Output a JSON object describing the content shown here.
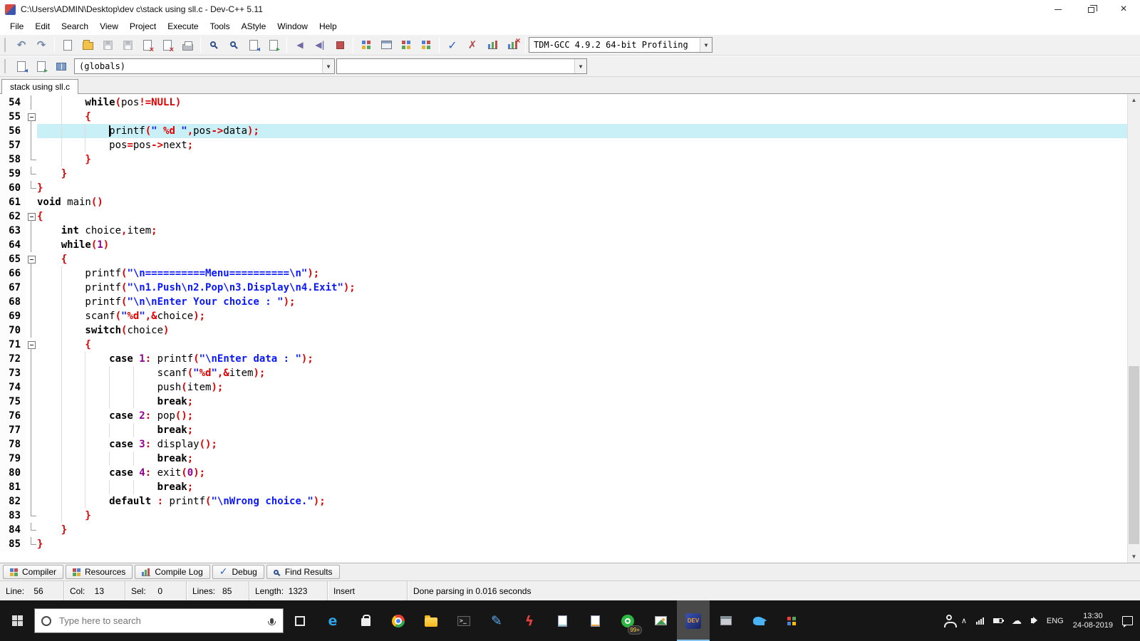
{
  "window": {
    "title": "C:\\Users\\ADMIN\\Desktop\\dev c\\stack using sll.c - Dev-C++ 5.11"
  },
  "menu": {
    "items": [
      "File",
      "Edit",
      "Search",
      "View",
      "Project",
      "Execute",
      "Tools",
      "AStyle",
      "Window",
      "Help"
    ]
  },
  "toolbar": {
    "compiler_profile": "TDM-GCC 4.9.2 64-bit Profiling",
    "globals_value": "(globals)",
    "second_value": ""
  },
  "tabs": [
    {
      "label": "stack using sll.c"
    }
  ],
  "editor": {
    "lines": [
      {
        "n": 54,
        "fold": "vline",
        "indent": 8,
        "tokens": [
          [
            "kw",
            "while"
          ],
          [
            "sym",
            "("
          ],
          [
            "pl",
            "pos"
          ],
          [
            "sym",
            "!="
          ],
          [
            "sym",
            "NULL"
          ],
          [
            "sym",
            ")"
          ]
        ]
      },
      {
        "n": 55,
        "fold": "box",
        "indent": 8,
        "tokens": [
          [
            "sym",
            "{"
          ]
        ]
      },
      {
        "n": 56,
        "fold": "vline",
        "indent": 12,
        "current": true,
        "caret_col": 13,
        "tokens": [
          [
            "pl",
            "printf"
          ],
          [
            "sym",
            "("
          ],
          [
            "str",
            "\" "
          ],
          [
            "fmt",
            "%d"
          ],
          [
            "str",
            " \""
          ],
          [
            "sym",
            ","
          ],
          [
            "pl",
            "pos"
          ],
          [
            "sym",
            "->"
          ],
          [
            "pl",
            "data"
          ],
          [
            "sym",
            ");"
          ]
        ]
      },
      {
        "n": 57,
        "fold": "vline",
        "indent": 12,
        "tokens": [
          [
            "pl",
            "pos"
          ],
          [
            "sym",
            "="
          ],
          [
            "pl",
            "pos"
          ],
          [
            "sym",
            "->"
          ],
          [
            "pl",
            "next"
          ],
          [
            "sym",
            ";"
          ]
        ]
      },
      {
        "n": 58,
        "fold": "lend",
        "indent": 8,
        "tokens": [
          [
            "sym",
            "}"
          ]
        ]
      },
      {
        "n": 59,
        "fold": "lend",
        "indent": 4,
        "tokens": [
          [
            "sym",
            "}"
          ]
        ]
      },
      {
        "n": 60,
        "fold": "lend",
        "indent": 0,
        "tokens": [
          [
            "sym",
            "}"
          ]
        ]
      },
      {
        "n": 61,
        "fold": "none",
        "indent": 0,
        "tokens": [
          [
            "kw",
            "void"
          ],
          [
            "pl",
            " main"
          ],
          [
            "sym",
            "()"
          ]
        ]
      },
      {
        "n": 62,
        "fold": "box",
        "indent": 0,
        "tokens": [
          [
            "sym",
            "{"
          ]
        ]
      },
      {
        "n": 63,
        "fold": "vline",
        "indent": 4,
        "tokens": [
          [
            "kw",
            "int"
          ],
          [
            "pl",
            " choice"
          ],
          [
            "sym",
            ","
          ],
          [
            "pl",
            "item"
          ],
          [
            "sym",
            ";"
          ]
        ]
      },
      {
        "n": 64,
        "fold": "vline",
        "indent": 4,
        "tokens": [
          [
            "kw",
            "while"
          ],
          [
            "sym",
            "("
          ],
          [
            "num",
            "1"
          ],
          [
            "sym",
            ")"
          ]
        ]
      },
      {
        "n": 65,
        "fold": "box",
        "indent": 4,
        "tokens": [
          [
            "sym",
            "{"
          ]
        ]
      },
      {
        "n": 66,
        "fold": "vline",
        "indent": 8,
        "tokens": [
          [
            "pl",
            "printf"
          ],
          [
            "sym",
            "("
          ],
          [
            "str",
            "\"\\n==========Menu==========\\n\""
          ],
          [
            "sym",
            ");"
          ]
        ]
      },
      {
        "n": 67,
        "fold": "vline",
        "indent": 8,
        "tokens": [
          [
            "pl",
            "printf"
          ],
          [
            "sym",
            "("
          ],
          [
            "str",
            "\"\\n1.Push\\n2.Pop\\n3.Display\\n4.Exit\""
          ],
          [
            "sym",
            ");"
          ]
        ]
      },
      {
        "n": 68,
        "fold": "vline",
        "indent": 8,
        "tokens": [
          [
            "pl",
            "printf"
          ],
          [
            "sym",
            "("
          ],
          [
            "str",
            "\"\\n\\nEnter Your choice : \""
          ],
          [
            "sym",
            ");"
          ]
        ]
      },
      {
        "n": 69,
        "fold": "vline",
        "indent": 8,
        "tokens": [
          [
            "pl",
            "scanf"
          ],
          [
            "sym",
            "("
          ],
          [
            "str",
            "\""
          ],
          [
            "fmt",
            "%d"
          ],
          [
            "str",
            "\""
          ],
          [
            "sym",
            ",&"
          ],
          [
            "pl",
            "choice"
          ],
          [
            "sym",
            ");"
          ]
        ]
      },
      {
        "n": 70,
        "fold": "vline",
        "indent": 8,
        "tokens": [
          [
            "kw",
            "switch"
          ],
          [
            "sym",
            "("
          ],
          [
            "pl",
            "choice"
          ],
          [
            "sym",
            ")"
          ]
        ]
      },
      {
        "n": 71,
        "fold": "box",
        "indent": 8,
        "tokens": [
          [
            "sym",
            "{"
          ]
        ]
      },
      {
        "n": 72,
        "fold": "vline",
        "indent": 12,
        "tokens": [
          [
            "kw",
            "case"
          ],
          [
            "pl",
            " "
          ],
          [
            "num",
            "1"
          ],
          [
            "sym",
            ":"
          ],
          [
            "pl",
            " printf"
          ],
          [
            "sym",
            "("
          ],
          [
            "str",
            "\"\\nEnter data : \""
          ],
          [
            "sym",
            ");"
          ]
        ]
      },
      {
        "n": 73,
        "fold": "vline",
        "indent": 20,
        "tokens": [
          [
            "pl",
            "scanf"
          ],
          [
            "sym",
            "("
          ],
          [
            "str",
            "\""
          ],
          [
            "fmt",
            "%d"
          ],
          [
            "str",
            "\""
          ],
          [
            "sym",
            ",&"
          ],
          [
            "pl",
            "item"
          ],
          [
            "sym",
            ");"
          ]
        ]
      },
      {
        "n": 74,
        "fold": "vline",
        "indent": 20,
        "tokens": [
          [
            "pl",
            "push"
          ],
          [
            "sym",
            "("
          ],
          [
            "pl",
            "item"
          ],
          [
            "sym",
            ");"
          ]
        ]
      },
      {
        "n": 75,
        "fold": "vline",
        "indent": 20,
        "tokens": [
          [
            "kw",
            "break"
          ],
          [
            "sym",
            ";"
          ]
        ]
      },
      {
        "n": 76,
        "fold": "vline",
        "indent": 12,
        "tokens": [
          [
            "kw",
            "case"
          ],
          [
            "pl",
            " "
          ],
          [
            "num",
            "2"
          ],
          [
            "sym",
            ":"
          ],
          [
            "pl",
            " pop"
          ],
          [
            "sym",
            "();"
          ]
        ]
      },
      {
        "n": 77,
        "fold": "vline",
        "indent": 20,
        "tokens": [
          [
            "kw",
            "break"
          ],
          [
            "sym",
            ";"
          ]
        ]
      },
      {
        "n": 78,
        "fold": "vline",
        "indent": 12,
        "tokens": [
          [
            "kw",
            "case"
          ],
          [
            "pl",
            " "
          ],
          [
            "num",
            "3"
          ],
          [
            "sym",
            ":"
          ],
          [
            "pl",
            " display"
          ],
          [
            "sym",
            "();"
          ]
        ]
      },
      {
        "n": 79,
        "fold": "vline",
        "indent": 20,
        "tokens": [
          [
            "kw",
            "break"
          ],
          [
            "sym",
            ";"
          ]
        ]
      },
      {
        "n": 80,
        "fold": "vline",
        "indent": 12,
        "tokens": [
          [
            "kw",
            "case"
          ],
          [
            "pl",
            " "
          ],
          [
            "num",
            "4"
          ],
          [
            "sym",
            ":"
          ],
          [
            "pl",
            " exit"
          ],
          [
            "sym",
            "("
          ],
          [
            "num",
            "0"
          ],
          [
            "sym",
            ");"
          ]
        ]
      },
      {
        "n": 81,
        "fold": "vline",
        "indent": 20,
        "tokens": [
          [
            "kw",
            "break"
          ],
          [
            "sym",
            ";"
          ]
        ]
      },
      {
        "n": 82,
        "fold": "vline",
        "indent": 12,
        "tokens": [
          [
            "kw",
            "default"
          ],
          [
            "pl",
            " "
          ],
          [
            "sym",
            ":"
          ],
          [
            "pl",
            " printf"
          ],
          [
            "sym",
            "("
          ],
          [
            "str",
            "\"\\nWrong choice.\""
          ],
          [
            "sym",
            ");"
          ]
        ]
      },
      {
        "n": 83,
        "fold": "lend",
        "indent": 8,
        "tokens": [
          [
            "sym",
            "}"
          ]
        ]
      },
      {
        "n": 84,
        "fold": "lend",
        "indent": 4,
        "tokens": [
          [
            "sym",
            "}"
          ]
        ]
      },
      {
        "n": 85,
        "fold": "lend",
        "indent": 0,
        "tokens": [
          [
            "sym",
            "}"
          ]
        ]
      }
    ]
  },
  "panel_tabs": [
    {
      "label": "Compiler",
      "icon": "grid"
    },
    {
      "label": "Resources",
      "icon": "grid2"
    },
    {
      "label": "Compile Log",
      "icon": "chart"
    },
    {
      "label": "Debug",
      "icon": "check"
    },
    {
      "label": "Find Results",
      "icon": "mag"
    }
  ],
  "statusbar": {
    "line": "Line:    56",
    "col": "Col:    13",
    "sel": "Sel:     0",
    "lines": "Lines:   85",
    "length": "Length:  1323",
    "mode": "Insert",
    "message": "Done parsing in 0.016 seconds"
  },
  "taskbar": {
    "search_placeholder": "Type here to search",
    "language": "ENG",
    "time": "13:30",
    "date": "24-08-2019",
    "apps": [
      {
        "id": "task-view",
        "kind": "taskview"
      },
      {
        "id": "edge",
        "kind": "glyph",
        "glyph": "e",
        "color": "#2ea3e8"
      },
      {
        "id": "store",
        "kind": "store"
      },
      {
        "id": "chrome",
        "kind": "chrome"
      },
      {
        "id": "file-explorer",
        "kind": "folder"
      },
      {
        "id": "console",
        "kind": "terminal",
        "glyph": ">_"
      },
      {
        "id": "pen-app",
        "kind": "glyph",
        "glyph": "✎",
        "color": "#5aa7e8"
      },
      {
        "id": "flash",
        "kind": "glyph",
        "glyph": "ϟ",
        "color": "#e8413c"
      },
      {
        "id": "document-app",
        "kind": "doc"
      },
      {
        "id": "writer-app",
        "kind": "doc-orange"
      },
      {
        "id": "chat-app",
        "kind": "whatsapp",
        "badge": "99+"
      },
      {
        "id": "photos-app",
        "kind": "image"
      },
      {
        "id": "dev-cpp",
        "kind": "devcpp",
        "label": "DEV",
        "active": true
      },
      {
        "id": "window-app",
        "kind": "window"
      },
      {
        "id": "twitter",
        "kind": "twitter"
      },
      {
        "id": "tiles-app",
        "kind": "tiles"
      }
    ]
  }
}
